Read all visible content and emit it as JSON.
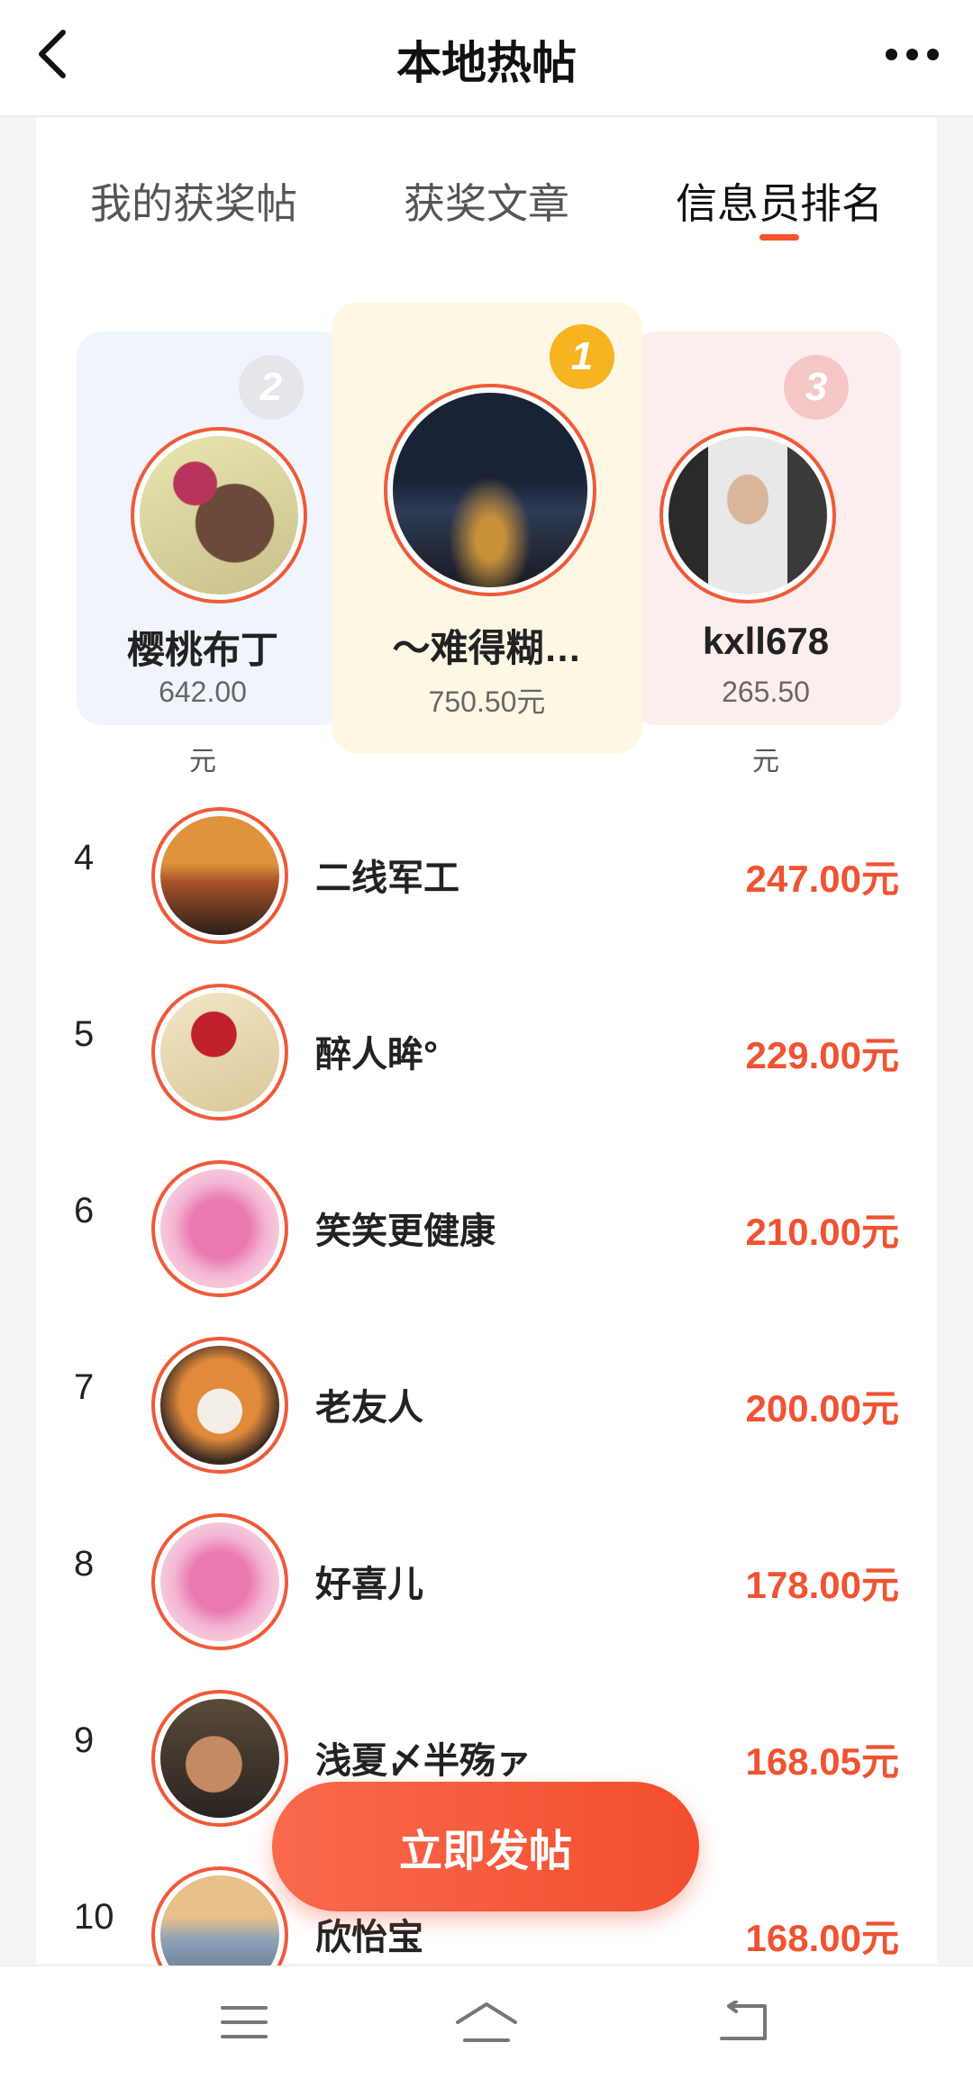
{
  "header": {
    "title": "本地热帖"
  },
  "tabs": [
    {
      "label": "我的获奖帖"
    },
    {
      "label": "获奖文章"
    },
    {
      "label": "信息员排名"
    }
  ],
  "podium": [
    {
      "rank": 2,
      "badge": "2",
      "name": "樱桃布丁",
      "amount": "642.00",
      "unit": "元"
    },
    {
      "rank": 1,
      "badge": "1",
      "name": "～难得糊…",
      "amount": "750.50元"
    },
    {
      "rank": 3,
      "badge": "3",
      "name": "kxll678",
      "amount": "265.50",
      "unit": "元"
    }
  ],
  "ranking": [
    {
      "num": "4",
      "name": "二线军工",
      "amount": "247.00元"
    },
    {
      "num": "5",
      "name": "醉人眸°",
      "amount": "229.00元"
    },
    {
      "num": "6",
      "name": "笑笑更健康",
      "amount": "210.00元"
    },
    {
      "num": "7",
      "name": "老友人",
      "amount": "200.00元"
    },
    {
      "num": "8",
      "name": "好喜儿",
      "amount": "178.00元"
    },
    {
      "num": "9",
      "name": "浅夏〆半殇ァ",
      "amount": "168.05元"
    },
    {
      "num": "10",
      "name": "欣怡宝",
      "amount": "168.00元"
    }
  ],
  "post_button": {
    "label": "立即发帖"
  },
  "colors": {
    "accent": "#ef5332",
    "tab_indicator": "#f5542f",
    "gold": "#f7b320"
  },
  "icons": [
    "back-icon",
    "more-icon",
    "menu-icon",
    "home-icon",
    "return-icon"
  ]
}
